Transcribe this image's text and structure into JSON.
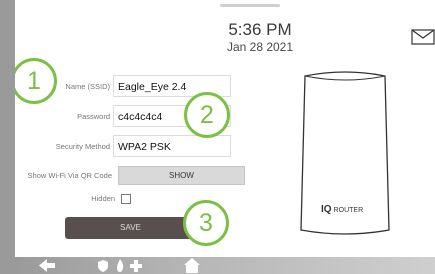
{
  "header": {
    "time": "5:36 PM",
    "date": "Jan 28 2021"
  },
  "form": {
    "ssid_label": "Name (SSID)",
    "ssid_value": "Eagle_Eye 2.4",
    "password_label": "Password",
    "password_value": "c4c4c4c4",
    "security_label": "Security Method",
    "security_value": "WPA2 PSK",
    "qr_label": "Show Wi-Fi Via QR Code",
    "show_label": "SHOW",
    "hidden_label": "Hidden",
    "save_label": "SAVE"
  },
  "router": {
    "brand_iq": "IQ",
    "brand_router": "ROUTER"
  },
  "callouts": [
    "1",
    "2",
    "3"
  ],
  "icons": [
    "back-arrow-icon",
    "shield-icon",
    "flame-icon",
    "plus-icon",
    "home-icon",
    "envelope-icon"
  ],
  "colors": {
    "callout": "#7bc043",
    "save_button": "#5a4f4f",
    "show_button": "#d9d9d9"
  }
}
